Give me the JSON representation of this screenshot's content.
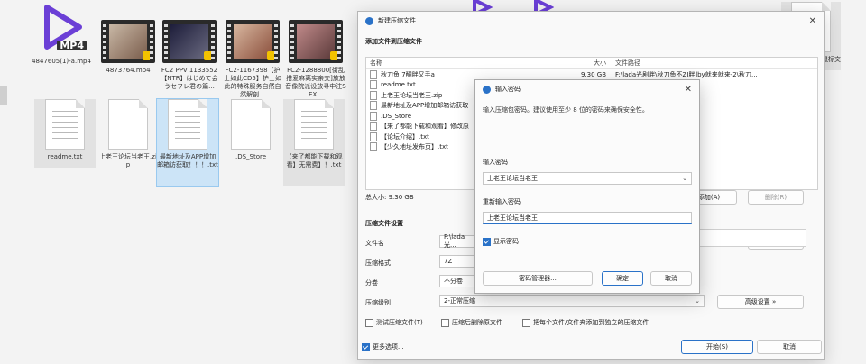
{
  "explorer": {
    "row1": [
      {
        "caption": "4847605(1)-a.mp4",
        "kind": "mp4",
        "badge": "MP4"
      },
      {
        "caption": "4873764.mp4",
        "kind": "video"
      },
      {
        "caption": "FC2 PPV 1133552 【NTR】はじめて会うセフレ君の篇...",
        "kind": "video"
      },
      {
        "caption": "FC2-1167398【护士如此CD5】护士如此的特殊服务自然自然解剖...",
        "kind": "video"
      },
      {
        "caption": "FC2-1288800[街乱搭爱麻离实亲交]放放音像院派设放寻中注SEX...",
        "kind": "video"
      }
    ],
    "row2": [
      {
        "caption": "readme.txt"
      },
      {
        "caption": "上老王论坛当老王.zip"
      },
      {
        "caption": "最新地址及APP增加邮箱访获取！！！.txt"
      },
      {
        "caption": ".DS_Store"
      },
      {
        "caption": "【来了都能下载和观看】无需费】！.txt"
      }
    ],
    "right_partial": "鼠标文"
  },
  "compress_dialog": {
    "title": "新建压缩文件",
    "section_title": "添加文件到压缩文件",
    "columns": {
      "name": "名称",
      "size": "大小",
      "path": "文件路径"
    },
    "files": [
      {
        "name": "秋刀鱼 7酮胖又手a",
        "size": "9.30 GB",
        "path": "F:\\lada光剧胖\\秋刀鱼不ZI胖]by就来就来-2\\秋刀..."
      },
      {
        "name": "readme.txt",
        "size": "",
        "path": "…by就来就来-2\\rea..."
      },
      {
        "name": "上老王论坛当老王.zip",
        "size": "",
        "path": "…by就来就来-2\\上老..."
      },
      {
        "name": "最新地址及APP增加邮箱访获取",
        "size": "",
        "path": "…by就来就来-2\\最新..."
      },
      {
        "name": ".DS_Store",
        "size": "",
        "path": "…by就来就来-2\\.DS_..."
      },
      {
        "name": "【来了都能下载和观看】修改原",
        "size": "",
        "path": "…by就来就来-2\\【来..."
      },
      {
        "name": "【论坛介绍】.txt",
        "size": "",
        "path": "…by就来就来-2\\【论..."
      },
      {
        "name": "【少久地址发布页】.txt",
        "size": "",
        "path": "…by就来就来-2\\【少..."
      }
    ],
    "total_label": "总大小: 9.30 GB",
    "add_button": "添加(A)",
    "remove_button": "删除(R)",
    "options_header": "压缩文件设置",
    "file_name_label": "文件名",
    "file_name_value": "F:\\lada光...",
    "browse_button": "浏览(B)...",
    "format_label": "压缩格式",
    "format_value": "7Z",
    "split_label": "分卷",
    "split_value": "不分卷",
    "level_label": "压缩级别",
    "level_value": "2-正常压缩",
    "advanced_button": "高级设置 »",
    "chk_test": "测试压缩文件(T)",
    "chk_delete": "压缩后删除原文件",
    "chk_each": "把每个文件/文件夹添加到独立的压缩文件",
    "chk_more": "更多选项...",
    "start_button": "开始(S)",
    "cancel_button": "取消"
  },
  "password_dialog": {
    "title": "输入密码",
    "description": "输入压缩包密码。建议使用至少 8 位的密码来确保安全性。",
    "enter_label": "输入密码",
    "enter_value": "上老王论坛当老王",
    "reenter_label": "重新输入密码",
    "reenter_value": "上老王论坛当老王",
    "show_password": "显示密码",
    "manager_button": "密码管理器...",
    "ok_button": "确定",
    "cancel_button": "取消"
  },
  "colors": {
    "accent": "#2a72c8",
    "purple": "#6b3fd6"
  }
}
